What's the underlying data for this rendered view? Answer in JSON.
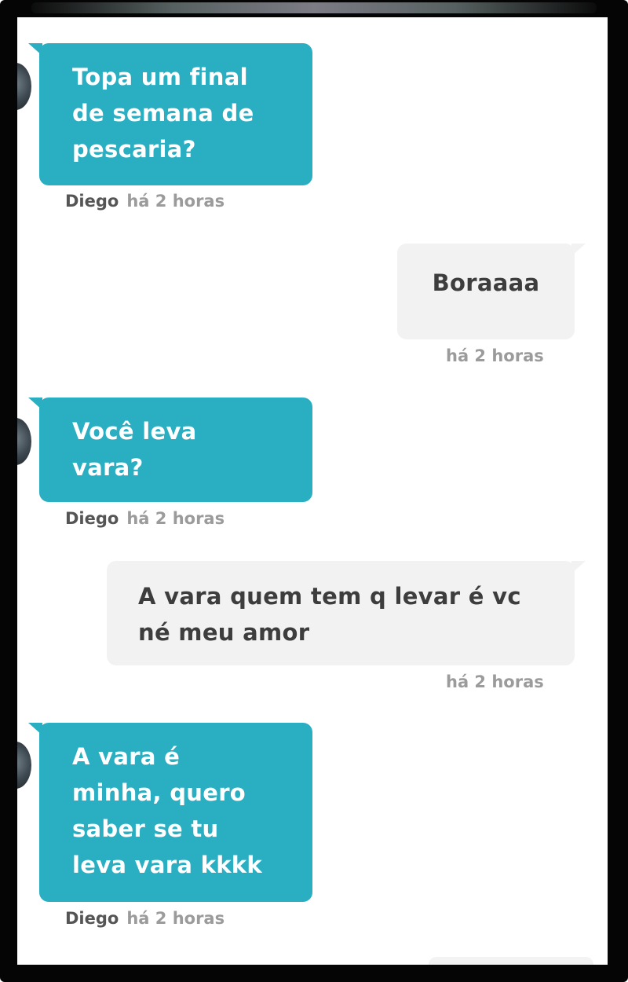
{
  "colors": {
    "incoming_bubble": "#29aec2",
    "outgoing_bubble": "#f2f2f2",
    "frame": "#050505"
  },
  "messages": [
    {
      "direction": "incoming",
      "text": "Topa um final de semana de pescaria?",
      "lines": [
        "Topa um final",
        "de semana de",
        "pescaria?"
      ],
      "sender": "Diego",
      "time": "há 2 horas"
    },
    {
      "direction": "outgoing",
      "text": "Boraaaa",
      "lines": [
        "Boraaaa"
      ],
      "sender": "",
      "time": "há 2 horas"
    },
    {
      "direction": "incoming",
      "text": "Você leva vara?",
      "lines": [
        "Você leva",
        "vara?"
      ],
      "sender": "Diego",
      "time": "há 2 horas"
    },
    {
      "direction": "outgoing",
      "text": "A vara quem tem q levar é vc né meu amor",
      "lines": [
        "A vara quem tem q levar é vc",
        "né meu amor"
      ],
      "sender": "",
      "time": "há 2 horas"
    },
    {
      "direction": "incoming",
      "text": "A vara é minha, quero saber se tu leva vara kkkk",
      "lines": [
        "A vara é",
        "minha, quero",
        "saber se tu",
        "leva vara kkkk"
      ],
      "sender": "Diego",
      "time": "há 2 horas"
    }
  ]
}
